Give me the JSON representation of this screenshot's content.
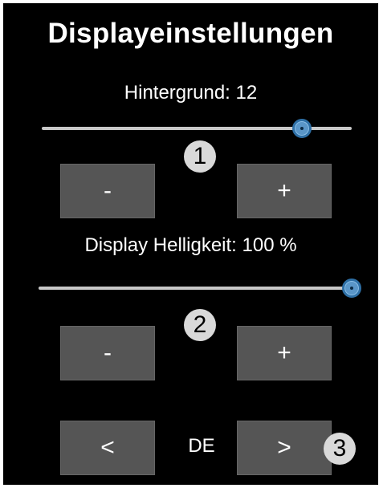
{
  "title": "Displayeinstellungen",
  "background": {
    "label": "Hintergrund: 12",
    "slider_value_fraction": 0.84,
    "minus_label": "-",
    "plus_label": "+",
    "badge": "1"
  },
  "brightness": {
    "label": "Display Helligkeit: 100 %",
    "slider_value_fraction": 1.0,
    "minus_label": "-",
    "plus_label": "+",
    "badge": "2"
  },
  "language": {
    "prev_label": "<",
    "value": "DE",
    "next_label": ">",
    "badge": "3"
  },
  "colors": {
    "background": "#000000",
    "button": "#555555",
    "slider_thumb": "#5a96c8",
    "badge": "#d9d9d9"
  }
}
